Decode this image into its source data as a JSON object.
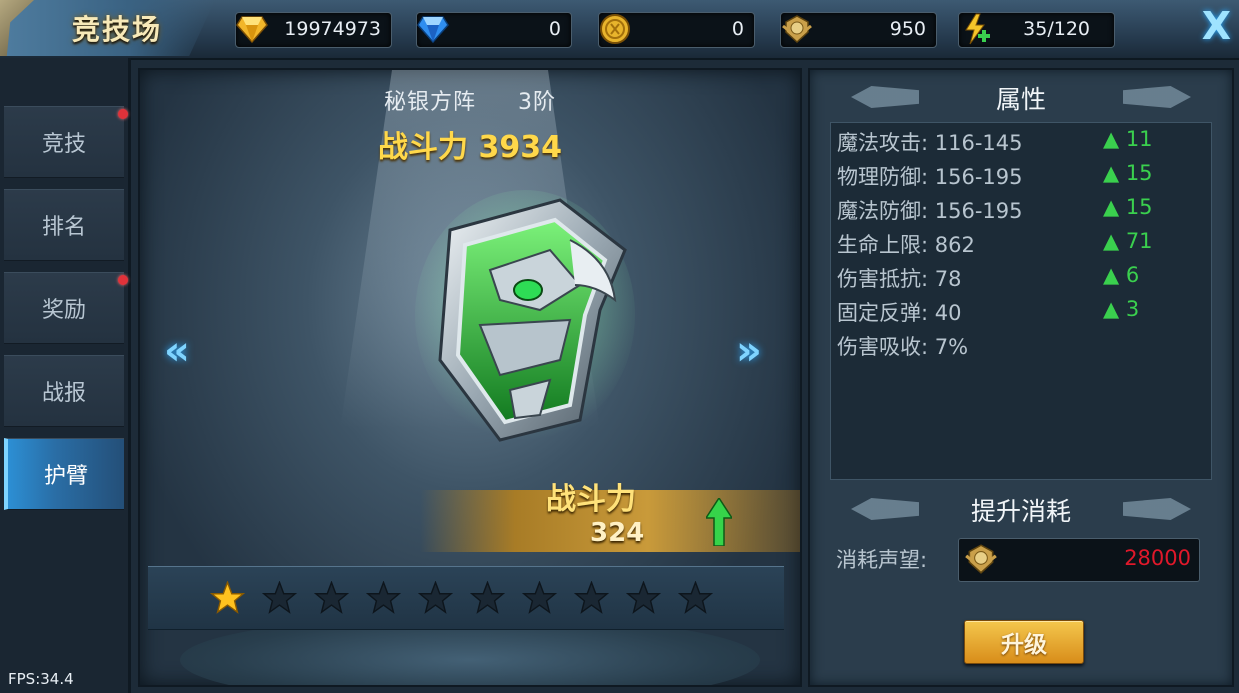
{
  "header": {
    "title": "竞技场",
    "resources": [
      {
        "icon": "gold-gem-icon",
        "value": "19974973"
      },
      {
        "icon": "diamond-icon",
        "value": "0"
      },
      {
        "icon": "gold-coin-icon",
        "value": "0"
      },
      {
        "icon": "honor-badge-icon",
        "value": "950"
      },
      {
        "icon": "stamina-add-icon",
        "value": "35/120"
      }
    ],
    "close_label": "X"
  },
  "sidebar": {
    "tabs": [
      {
        "label": "竞技",
        "red_dot": true
      },
      {
        "label": "排名",
        "red_dot": false
      },
      {
        "label": "奖励",
        "red_dot": true
      },
      {
        "label": "战报",
        "red_dot": false
      },
      {
        "label": "护臂",
        "red_dot": false,
        "active": true
      }
    ]
  },
  "item": {
    "name": "秘银方阵",
    "tier": "3阶",
    "power_label": "战斗力",
    "power_value": "3934",
    "gain_label": "战斗力",
    "gain_value": "324",
    "prev_arrow": "«",
    "next_arrow": "»",
    "stars_total": 10,
    "stars_filled": 1
  },
  "attributes": {
    "title": "属性",
    "rows": [
      {
        "name": "魔法攻击: 116-145",
        "inc": "▲ 11"
      },
      {
        "name": "物理防御: 156-195",
        "inc": "▲ 15"
      },
      {
        "name": "魔法防御: 156-195",
        "inc": "▲ 15"
      },
      {
        "name": "生命上限: 862",
        "inc": "▲ 71"
      },
      {
        "name": "伤害抵抗: 78",
        "inc": "▲ 6"
      },
      {
        "name": "固定反弹: 40",
        "inc": "▲ 3"
      },
      {
        "name": "伤害吸收: 7%",
        "inc": ""
      }
    ]
  },
  "upgrade": {
    "title": "提升消耗",
    "cost_label": "消耗声望:",
    "cost_value": "28000",
    "button_label": "升级"
  },
  "fps": "FPS:34.4",
  "colors": {
    "accent_gold": "#ffd84a",
    "increase_green": "#3ad04e",
    "cost_red": "#e0182a",
    "active_tab": "#2c8fd4"
  }
}
